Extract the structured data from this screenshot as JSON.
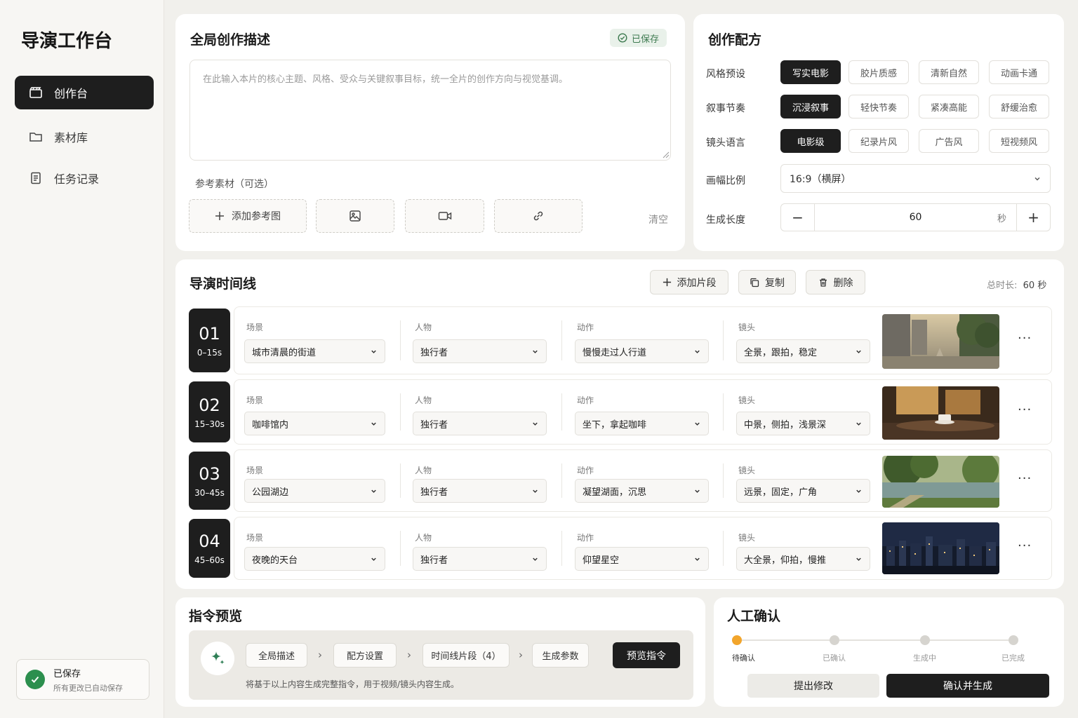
{
  "sidebar": {
    "title": "导演工作台",
    "items": [
      {
        "label": "创作台",
        "icon": "clapperboard-icon",
        "active": true
      },
      {
        "label": "素材库",
        "icon": "folder-icon",
        "active": false
      },
      {
        "label": "任务记录",
        "icon": "document-icon",
        "active": false
      }
    ],
    "saved": {
      "title": "已保存",
      "subtitle": "所有更改已自动保存"
    }
  },
  "global": {
    "title": "全局创作描述",
    "saved_badge": "已保存",
    "placeholder": "在此输入本片的核心主题、风格、受众与关键叙事目标，统一全片的创作方向与视觉基调。",
    "ref_label": "参考素材（可选）",
    "add_ref": "添加参考图",
    "clear": "清空"
  },
  "recipe": {
    "title": "创作配方",
    "style": {
      "label": "风格预设",
      "options": [
        "写实电影",
        "胶片质感",
        "清新自然",
        "动画卡通"
      ],
      "selected": 0
    },
    "rhythm": {
      "label": "叙事节奏",
      "options": [
        "沉浸叙事",
        "轻快节奏",
        "紧凑高能",
        "舒缓治愈"
      ],
      "selected": 0
    },
    "lens": {
      "label": "镜头语言",
      "options": [
        "电影级",
        "纪录片风",
        "广告风",
        "短视频风"
      ],
      "selected": 0
    },
    "ratio": {
      "label": "画幅比例",
      "value": "16:9（横屏）"
    },
    "length": {
      "label": "生成长度",
      "value": "60",
      "unit": "秒",
      "minus": "−",
      "plus": "+"
    }
  },
  "timeline": {
    "title": "导演时间线",
    "add_label": "添加片段",
    "copy_label": "复制",
    "delete_label": "删除",
    "total_label": "总时长:",
    "total_value": "60 秒",
    "field_labels": {
      "scene": "场景",
      "character": "人物",
      "action": "动作",
      "camera": "镜头"
    },
    "more": "···",
    "segments": [
      {
        "num": "01",
        "time": "0–15s",
        "scene": "城市清晨的街道",
        "character": "独行者",
        "action": "慢慢走过人行道",
        "camera": "全景，跟拍，稳定"
      },
      {
        "num": "02",
        "time": "15–30s",
        "scene": "咖啡馆内",
        "character": "独行者",
        "action": "坐下，拿起咖啡",
        "camera": "中景，侧拍，浅景深"
      },
      {
        "num": "03",
        "time": "30–45s",
        "scene": "公园湖边",
        "character": "独行者",
        "action": "凝望湖面，沉思",
        "camera": "远景，固定，广角"
      },
      {
        "num": "04",
        "time": "45–60s",
        "scene": "夜晚的天台",
        "character": "独行者",
        "action": "仰望星空",
        "camera": "大全景，仰拍，慢推"
      }
    ]
  },
  "preview": {
    "title": "指令预览",
    "crumbs": [
      "全局描述",
      "配方设置",
      "时间线片段（4）",
      "生成参数"
    ],
    "sep": "›",
    "button": "预览指令",
    "note": "将基于以上内容生成完整指令，用于视频/镜头内容生成。"
  },
  "confirm": {
    "title": "人工确认",
    "steps": [
      "待确认",
      "已确认",
      "生成中",
      "已完成"
    ],
    "current": 0,
    "revise": "提出修改",
    "confirm": "确认并生成"
  },
  "colors": {
    "accent_dark": "#1e1e1e",
    "success": "#2c8f4e",
    "progress_current": "#f2a52b",
    "background": "#f1f0ec"
  }
}
